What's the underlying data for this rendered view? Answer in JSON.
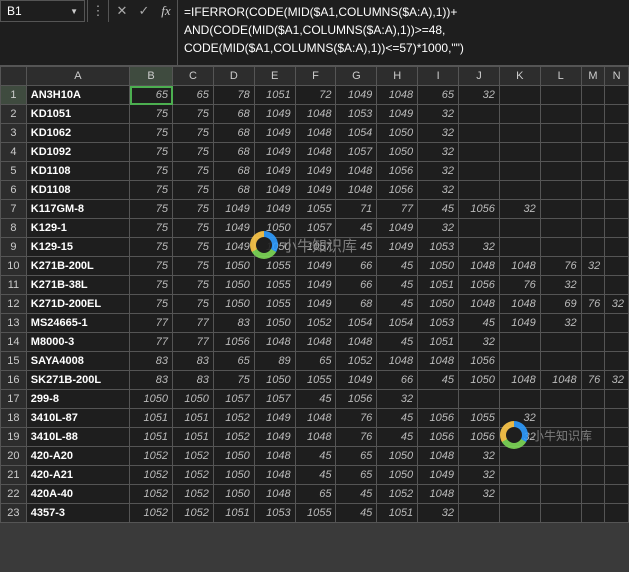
{
  "formula_bar": {
    "selected_cell": "B1",
    "formula": "=IFERROR(CODE(MID($A1,COLUMNS($A:A),1))+\nAND(CODE(MID($A1,COLUMNS($A:A),1))>=48,\nCODE(MID($A1,COLUMNS($A:A),1))<=57)*1000,\"\")"
  },
  "columns": [
    "A",
    "B",
    "C",
    "D",
    "E",
    "F",
    "G",
    "H",
    "I",
    "J",
    "K",
    "L",
    "M",
    "N"
  ],
  "col_classes": [
    "col-A",
    "col-B",
    "col-std",
    "col-std",
    "col-std",
    "col-std",
    "col-std",
    "col-std",
    "col-std",
    "col-std",
    "col-std",
    "col-std",
    "col-nar",
    "col-nar"
  ],
  "chart_data": {
    "type": "table",
    "rows": [
      {
        "n": 1,
        "a": "AN3H10A",
        "v": [
          65,
          65,
          78,
          1051,
          72,
          1049,
          1048,
          65,
          32,
          null,
          null,
          null,
          null
        ]
      },
      {
        "n": 2,
        "a": "KD1051",
        "v": [
          75,
          75,
          68,
          1049,
          1048,
          1053,
          1049,
          32,
          null,
          null,
          null,
          null,
          null
        ]
      },
      {
        "n": 3,
        "a": "KD1062",
        "v": [
          75,
          75,
          68,
          1049,
          1048,
          1054,
          1050,
          32,
          null,
          null,
          null,
          null,
          null
        ]
      },
      {
        "n": 4,
        "a": "KD1092",
        "v": [
          75,
          75,
          68,
          1049,
          1048,
          1057,
          1050,
          32,
          null,
          null,
          null,
          null,
          null
        ]
      },
      {
        "n": 5,
        "a": "KD1108",
        "v": [
          75,
          75,
          68,
          1049,
          1049,
          1048,
          1056,
          32,
          null,
          null,
          null,
          null,
          null
        ]
      },
      {
        "n": 6,
        "a": "KD1108",
        "v": [
          75,
          75,
          68,
          1049,
          1049,
          1048,
          1056,
          32,
          null,
          null,
          null,
          null,
          null
        ]
      },
      {
        "n": 7,
        "a": "K117GM-8",
        "v": [
          75,
          75,
          1049,
          1049,
          1055,
          71,
          77,
          45,
          1056,
          32,
          null,
          null,
          null
        ]
      },
      {
        "n": 8,
        "a": "K129-1",
        "v": [
          75,
          75,
          1049,
          1050,
          1057,
          45,
          1049,
          32,
          null,
          null,
          null,
          null,
          null
        ]
      },
      {
        "n": 9,
        "a": "K129-15",
        "v": [
          75,
          75,
          1049,
          1050,
          1057,
          45,
          1049,
          1053,
          32,
          null,
          null,
          null,
          null
        ]
      },
      {
        "n": 10,
        "a": "K271B-200L",
        "v": [
          75,
          75,
          1050,
          1055,
          1049,
          66,
          45,
          1050,
          1048,
          1048,
          76,
          32,
          null
        ]
      },
      {
        "n": 11,
        "a": "K271B-38L",
        "v": [
          75,
          75,
          1050,
          1055,
          1049,
          66,
          45,
          1051,
          1056,
          76,
          32,
          null,
          null
        ]
      },
      {
        "n": 12,
        "a": "K271D-200EL",
        "v": [
          75,
          75,
          1050,
          1055,
          1049,
          68,
          45,
          1050,
          1048,
          1048,
          69,
          76,
          32
        ]
      },
      {
        "n": 13,
        "a": "MS24665-1",
        "v": [
          77,
          77,
          83,
          1050,
          1052,
          1054,
          1054,
          1053,
          45,
          1049,
          32,
          null,
          null
        ]
      },
      {
        "n": 14,
        "a": "M8000-3",
        "v": [
          77,
          77,
          1056,
          1048,
          1048,
          1048,
          45,
          1051,
          32,
          null,
          null,
          null,
          null
        ]
      },
      {
        "n": 15,
        "a": "SAYA4008",
        "v": [
          83,
          83,
          65,
          89,
          65,
          1052,
          1048,
          1048,
          1056,
          null,
          null,
          null,
          null
        ]
      },
      {
        "n": 16,
        "a": "SK271B-200L",
        "v": [
          83,
          83,
          75,
          1050,
          1055,
          1049,
          66,
          45,
          1050,
          1048,
          1048,
          76,
          32
        ]
      },
      {
        "n": 17,
        "a": "299-8",
        "v": [
          1050,
          1050,
          1057,
          1057,
          45,
          1056,
          32,
          null,
          null,
          null,
          null,
          null,
          null
        ]
      },
      {
        "n": 18,
        "a": "3410L-87",
        "v": [
          1051,
          1051,
          1052,
          1049,
          1048,
          76,
          45,
          1056,
          1055,
          32,
          null,
          null,
          null
        ]
      },
      {
        "n": 19,
        "a": "3410L-88",
        "v": [
          1051,
          1051,
          1052,
          1049,
          1048,
          76,
          45,
          1056,
          1056,
          32,
          null,
          null,
          null
        ]
      },
      {
        "n": 20,
        "a": "420-A20",
        "v": [
          1052,
          1052,
          1050,
          1048,
          45,
          65,
          1050,
          1048,
          32,
          null,
          null,
          null,
          null
        ]
      },
      {
        "n": 21,
        "a": "420-A21",
        "v": [
          1052,
          1052,
          1050,
          1048,
          45,
          65,
          1050,
          1049,
          32,
          null,
          null,
          null,
          null
        ]
      },
      {
        "n": 22,
        "a": "420A-40",
        "v": [
          1052,
          1052,
          1050,
          1048,
          65,
          45,
          1052,
          1048,
          32,
          null,
          null,
          null,
          null
        ]
      },
      {
        "n": 23,
        "a": "4357-3",
        "v": [
          1052,
          1052,
          1051,
          1053,
          1055,
          45,
          1051,
          32,
          null,
          null,
          null,
          null,
          null
        ]
      }
    ]
  },
  "watermark": {
    "text1": "小牛知识库",
    "text2": "小牛知识库"
  }
}
